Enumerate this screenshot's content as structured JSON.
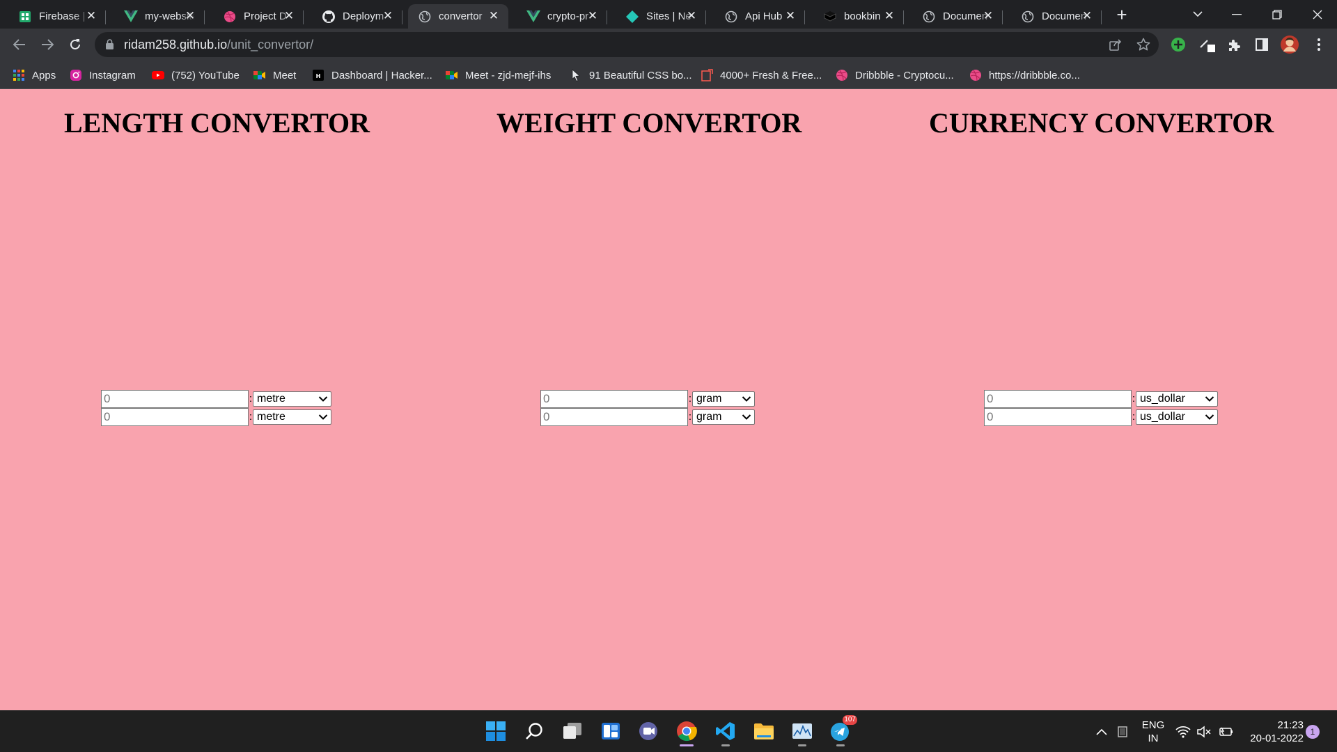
{
  "browser": {
    "tabs": [
      {
        "title": "Firebase |",
        "icon": "firebase-icon",
        "active": false
      },
      {
        "title": "my-website",
        "icon": "vue-icon",
        "active": false
      },
      {
        "title": "Project D",
        "icon": "dribbble-icon",
        "active": false
      },
      {
        "title": "Deploym",
        "icon": "github-icon",
        "active": false
      },
      {
        "title": "convertor",
        "icon": "globe-icon",
        "active": true
      },
      {
        "title": "crypto-pr",
        "icon": "vue-icon",
        "active": false
      },
      {
        "title": "Sites | Ne",
        "icon": "netlify-icon",
        "active": false
      },
      {
        "title": "Api Hub",
        "icon": "globe-icon",
        "active": false
      },
      {
        "title": "bookbin",
        "icon": "book-icon",
        "active": false
      },
      {
        "title": "Documen",
        "icon": "globe-icon",
        "active": false
      },
      {
        "title": "Documen",
        "icon": "globe-icon",
        "active": false
      }
    ],
    "url_host": "ridam258.github.io",
    "url_path": "/unit_convertor/",
    "bookmarks": [
      {
        "label": "Apps",
        "icon": "apps-grid-icon"
      },
      {
        "label": "Instagram",
        "icon": "instagram-icon"
      },
      {
        "label": "(752) YouTube",
        "icon": "youtube-icon"
      },
      {
        "label": "Meet",
        "icon": "meet-icon"
      },
      {
        "label": "Dashboard | Hacker...",
        "icon": "hackerrank-icon"
      },
      {
        "label": "Meet - zjd-mejf-ihs",
        "icon": "meet-icon"
      },
      {
        "label": "91 Beautiful CSS bo...",
        "icon": "cursor-icon"
      },
      {
        "label": "4000+ Fresh & Free...",
        "icon": "bookmark-page-icon"
      },
      {
        "label": "Dribbble - Cryptocu...",
        "icon": "dribbble-icon"
      },
      {
        "label": "https://dribbble.co...",
        "icon": "dribbble-icon"
      }
    ]
  },
  "page": {
    "length": {
      "heading": "LENGTH CONVERTOR",
      "rows": [
        {
          "value": "0",
          "unit": "metre"
        },
        {
          "value": "0",
          "unit": "metre"
        }
      ]
    },
    "weight": {
      "heading": "WEIGHT CONVERTOR",
      "rows": [
        {
          "value": "0",
          "unit": "gram"
        },
        {
          "value": "0",
          "unit": "gram"
        }
      ]
    },
    "currency": {
      "heading": "CURRENCY CONVERTOR",
      "rows": [
        {
          "value": "0",
          "unit": "us_dollar"
        },
        {
          "value": "0",
          "unit": "us_dollar"
        }
      ]
    },
    "separator": ":"
  },
  "taskbar": {
    "telegram_badge": "107",
    "language": "ENG",
    "region": "IN",
    "time": "21:23",
    "date": "20-01-2022",
    "notification_count": "1"
  },
  "colors": {
    "page_background": "#f9a3ae",
    "browser_dark": "#202124",
    "toolbar": "#35363a"
  }
}
